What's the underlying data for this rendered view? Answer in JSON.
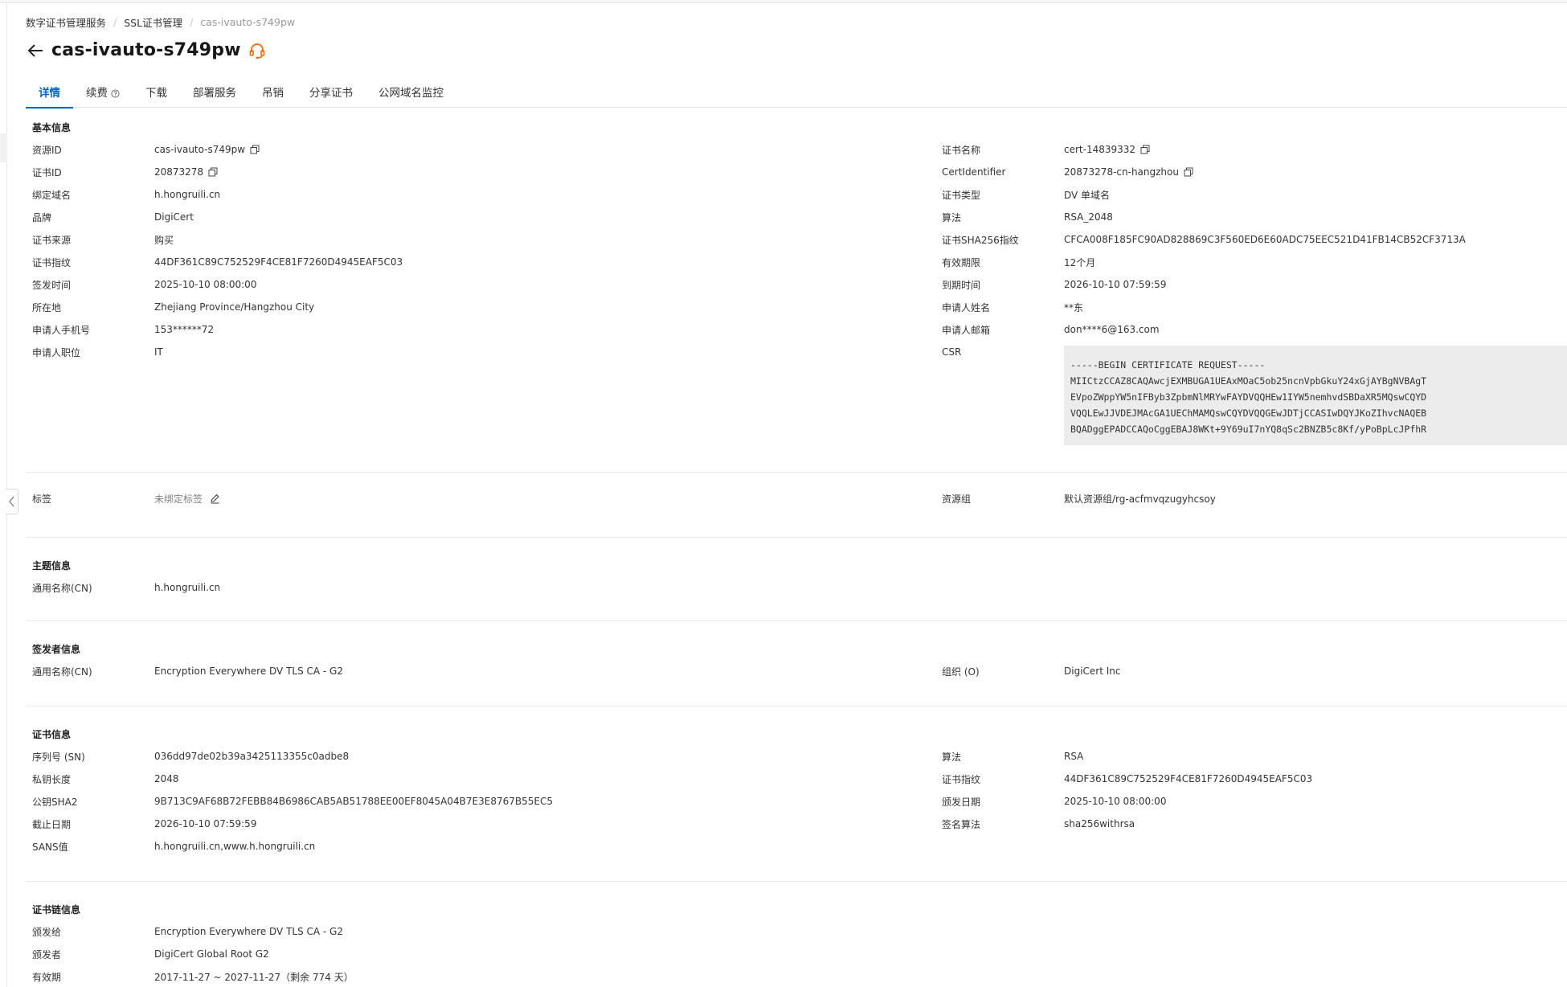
{
  "breadcrumb": [
    "数字证书管理服务",
    "SSL证书管理",
    "cas-ivauto-s749pw"
  ],
  "title": "cas-ivauto-s749pw",
  "tabs": [
    {
      "label": "详情"
    },
    {
      "label": "续费"
    },
    {
      "label": "下载"
    },
    {
      "label": "部署服务"
    },
    {
      "label": "吊销"
    },
    {
      "label": "分享证书"
    },
    {
      "label": "公网域名监控"
    }
  ],
  "basic": {
    "title": "基本信息",
    "left": [
      {
        "label": "资源ID",
        "value": "cas-ivauto-s749pw"
      },
      {
        "label": "证书ID",
        "value": "20873278"
      },
      {
        "label": "绑定域名",
        "value": "h.hongruili.cn"
      },
      {
        "label": "品牌",
        "value": "DigiCert"
      },
      {
        "label": "证书来源",
        "value": "购买"
      },
      {
        "label": "证书指纹",
        "value": "44DF361C89C752529F4CE81F7260D4945EAF5C03"
      },
      {
        "label": "签发时间",
        "value": "2025-10-10 08:00:00"
      },
      {
        "label": "所在地",
        "value": "Zhejiang Province/Hangzhou City"
      },
      {
        "label": "申请人手机号",
        "value": "153******72"
      },
      {
        "label": "申请人职位",
        "value": "IT"
      }
    ],
    "right": [
      {
        "label": "证书名称",
        "value": "cert-14839332"
      },
      {
        "label": "CertIdentifier",
        "value": "20873278-cn-hangzhou"
      },
      {
        "label": "证书类型",
        "value": "DV 单域名"
      },
      {
        "label": "算法",
        "value": "RSA_2048"
      },
      {
        "label": "证书SHA256指纹",
        "value": "CFCA008F185FC90AD828869C3F560ED6E60ADC75EEC521D41FB14CB52CF3713A"
      },
      {
        "label": "有效期限",
        "value": "12个月"
      },
      {
        "label": "到期时间",
        "value": "2026-10-10 07:59:59"
      },
      {
        "label": "申请人姓名",
        "value": "**东"
      },
      {
        "label": "申请人邮箱",
        "value": "don****6@163.com"
      },
      {
        "label": "CSR",
        "value": ""
      }
    ],
    "csr": "-----BEGIN CERTIFICATE REQUEST-----\nMIICtzCCAZ8CAQAwcjEXMBUGA1UEAxMOaC5ob25ncnVpbGkuY24xGjAYBgNVBAgT\nEVpoZWppYW5nIFByb3ZpbmNlMRYwFAYDVQQHEw1IYW5nemhvdSBDaXR5MQswCQYD\nVQQLEwJJVDEJMAcGA1UEChMAMQswCQYDVQQGEwJDTjCCASIwDQYJKoZIhvcNAQEB\nBQADggEPADCCAQoCggEBAJ8WKt+9Y69uI7nYQ8qSc2BNZB5c8Kf/yPoBpLcJPfhR"
  },
  "tags": {
    "label": "标签",
    "value": "未绑定标签",
    "rg_label": "资源组",
    "rg_value": "默认资源组/rg-acfmvqzugyhcsoy"
  },
  "subject": {
    "title": "主题信息",
    "rows": [
      {
        "label": "通用名称(CN)",
        "value": "h.hongruili.cn"
      }
    ]
  },
  "issuer": {
    "title": "签发者信息",
    "left": [
      {
        "label": "通用名称(CN)",
        "value": "Encryption Everywhere DV TLS CA - G2"
      }
    ],
    "right": [
      {
        "label": "组织 (O)",
        "value": "DigiCert Inc"
      }
    ]
  },
  "certinfo": {
    "title": "证书信息",
    "left": [
      {
        "label": "序列号 (SN)",
        "value": "036dd97de02b39a3425113355c0adbe8"
      },
      {
        "label": "私钥长度",
        "value": "2048"
      },
      {
        "label": "公钥SHA2",
        "value": "9B713C9AF68B72FEBB84B6986CAB5AB51788EE00EF8045A04B7E3E8767B55EC5"
      },
      {
        "label": "截止日期",
        "value": "2026-10-10 07:59:59"
      },
      {
        "label": "SANS值",
        "value": "h.hongruili.cn,www.h.hongruili.cn"
      }
    ],
    "right": [
      {
        "label": "算法",
        "value": "RSA"
      },
      {
        "label": "证书指纹",
        "value": "44DF361C89C752529F4CE81F7260D4945EAF5C03"
      },
      {
        "label": "颁发日期",
        "value": "2025-10-10 08:00:00"
      },
      {
        "label": "签名算法",
        "value": "sha256withrsa"
      }
    ]
  },
  "chain": {
    "title": "证书链信息",
    "rows": [
      {
        "label": "颁发给",
        "value": "Encryption Everywhere DV TLS CA - G2"
      },
      {
        "label": "颁发者",
        "value": "DigiCert Global Root G2"
      },
      {
        "label": "有效期",
        "value": "2017-11-27 ~ 2027-11-27（剩余 774 天）"
      }
    ]
  },
  "colors": {
    "accent": "#0064c8",
    "support_icon": "#ff6a00"
  }
}
